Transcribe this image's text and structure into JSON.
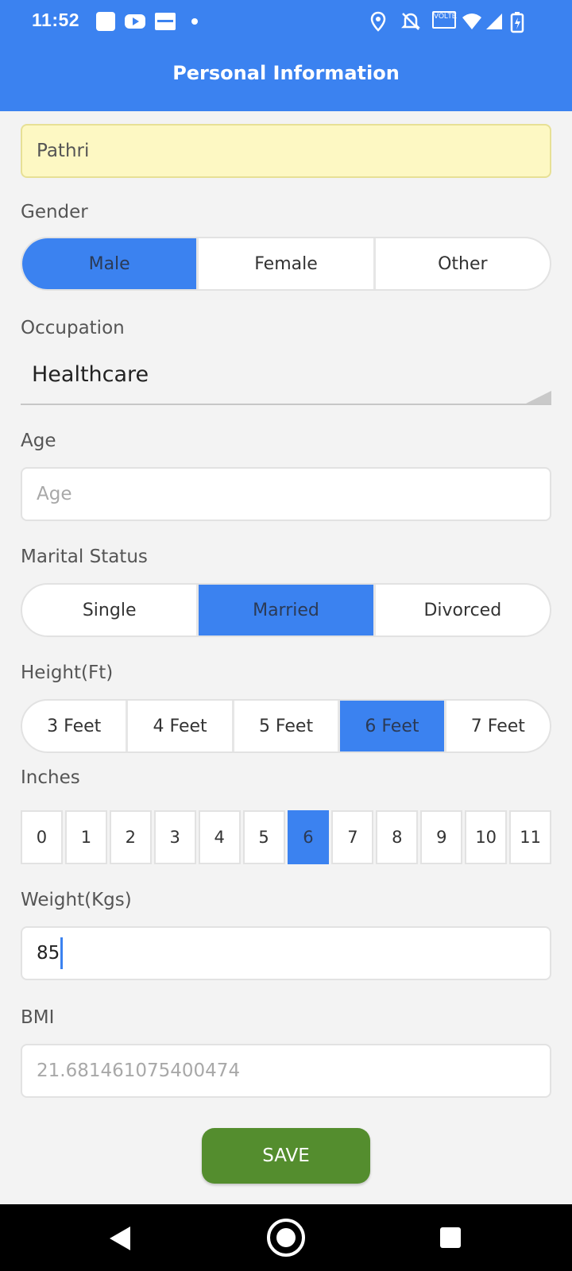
{
  "status_bar": {
    "time": "11:52",
    "network_badge": "VOLTE"
  },
  "app_bar": {
    "title": "Personal Information"
  },
  "form": {
    "name_value": "Pathri",
    "gender": {
      "label": "Gender",
      "options": [
        "Male",
        "Female",
        "Other"
      ],
      "selected": "Male"
    },
    "occupation": {
      "label": "Occupation",
      "value": "Healthcare"
    },
    "age": {
      "label": "Age",
      "placeholder": "Age",
      "value": ""
    },
    "marital_status": {
      "label": "Marital Status",
      "options": [
        "Single",
        "Married",
        "Divorced"
      ],
      "selected": "Married"
    },
    "height_ft": {
      "label": "Height(Ft)",
      "options": [
        "3 Feet",
        "4 Feet",
        "5 Feet",
        "6 Feet",
        "7 Feet"
      ],
      "selected": "6 Feet"
    },
    "inches": {
      "label": "Inches",
      "options": [
        "0",
        "1",
        "2",
        "3",
        "4",
        "5",
        "6",
        "7",
        "8",
        "9",
        "10",
        "11"
      ],
      "selected": "6"
    },
    "weight": {
      "label": "Weight(Kgs)",
      "value": "85"
    },
    "bmi": {
      "label": "BMI",
      "value": "21.681461075400474"
    },
    "save_label": "SAVE"
  },
  "colors": {
    "primary": "#3b82f0",
    "save": "#548d2e",
    "name_field_bg": "#fdf8c3"
  }
}
